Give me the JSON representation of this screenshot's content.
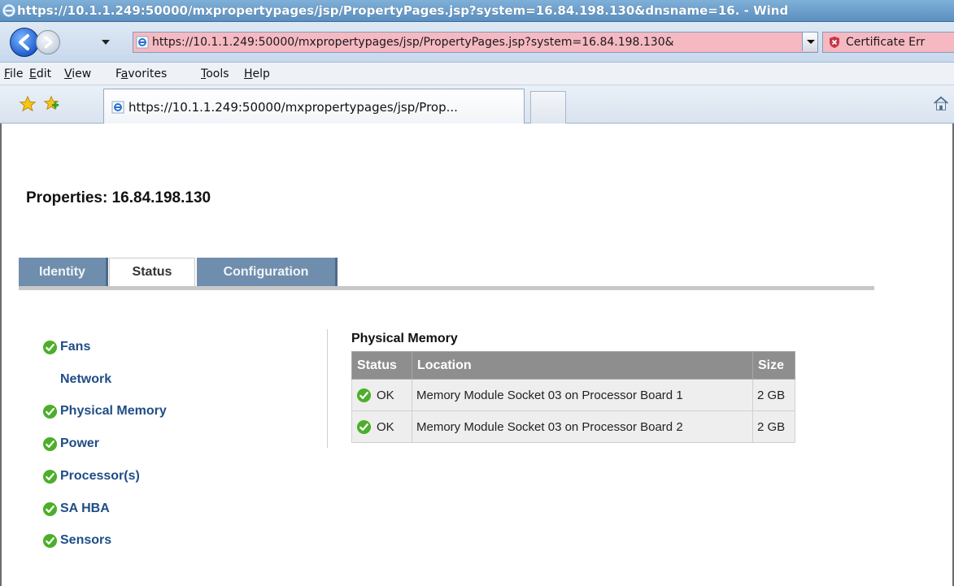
{
  "window": {
    "title": "https://10.1.1.249:50000/mxpropertypages/jsp/PropertyPages.jsp?system=16.84.198.130&dnsname=16. - Wind"
  },
  "address_bar": {
    "url": "https://10.1.1.249:50000/mxpropertypages/jsp/PropertyPages.jsp?system=16.84.198.130&",
    "certificate_label": "Certificate Err"
  },
  "menu": [
    {
      "pre": "",
      "u": "F",
      "post": "ile"
    },
    {
      "pre": "",
      "u": "E",
      "post": "dit"
    },
    {
      "pre": "",
      "u": "V",
      "post": "iew"
    },
    {
      "pre": "F",
      "u": "a",
      "post": "vorites"
    },
    {
      "pre": "",
      "u": "T",
      "post": "ools"
    },
    {
      "pre": "",
      "u": "H",
      "post": "elp"
    }
  ],
  "browser_tab": {
    "label": "https://10.1.1.249:50000/mxpropertypages/jsp/Prop..."
  },
  "page": {
    "title": "Properties: 16.84.198.130",
    "tabs": [
      {
        "label": "Identity",
        "active": false
      },
      {
        "label": "Status",
        "active": true
      },
      {
        "label": "Configuration",
        "active": false
      }
    ]
  },
  "status_nav": [
    {
      "label": "Fans",
      "status": "ok"
    },
    {
      "label": "Network",
      "status": "none"
    },
    {
      "label": "Physical Memory",
      "status": "ok"
    },
    {
      "label": "Power",
      "status": "ok"
    },
    {
      "label": "Processor(s)",
      "status": "ok"
    },
    {
      "label": "SA HBA",
      "status": "ok"
    },
    {
      "label": "Sensors",
      "status": "ok"
    }
  ],
  "physical_memory": {
    "title": "Physical Memory",
    "columns": [
      "Status",
      "Location",
      "Size"
    ],
    "rows": [
      {
        "status": "OK",
        "location": "Memory Module Socket 03 on Processor Board 1",
        "size": "2 GB"
      },
      {
        "status": "OK",
        "location": "Memory Module Socket 03 on Processor Board 2",
        "size": "2 GB"
      }
    ]
  },
  "colors": {
    "ok_green": "#4caf2a",
    "nav_link": "#1f4d86",
    "tab_inactive": "#6f8eae",
    "table_header": "#8e8e8e",
    "address_error_pink": "#f6b9c2"
  }
}
